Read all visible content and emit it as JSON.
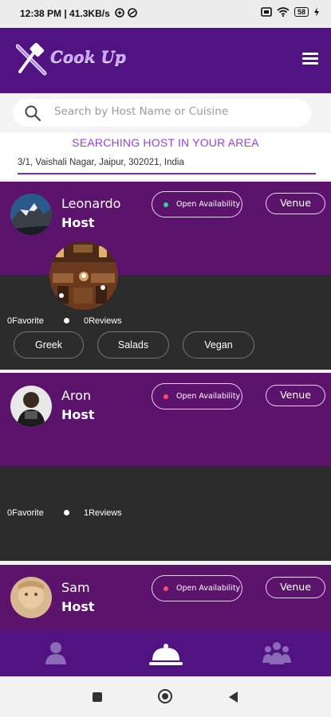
{
  "status_bar": {
    "time_speed": "12:38 PM | 41.3KB/s",
    "battery": "58"
  },
  "header": {
    "logo_text": "Cook Up"
  },
  "search": {
    "placeholder": "Search by Host Name or Cuisine",
    "value": ""
  },
  "area": {
    "title": "SEARCHING HOST IN YOUR AREA",
    "address": "3/1, Vaishali Nagar, Jaipur, 302021, India"
  },
  "hosts": [
    {
      "name": "Leonardo",
      "role": "Host",
      "availability_label": "Open Availability",
      "availability_color": "#2ed39b",
      "venue_label": "Venue",
      "favorites": "0Favorite",
      "reviews": "0Reviews",
      "cuisines": [
        "Greek",
        "Salads",
        "Vegan"
      ]
    },
    {
      "name": "Aron",
      "role": "Host",
      "availability_label": "Open Availability",
      "availability_color": "#ff4d6d",
      "venue_label": "Venue",
      "favorites": "0Favorite",
      "reviews": "1Reviews",
      "cuisines": []
    },
    {
      "name": "Sam",
      "role": "Host",
      "availability_label": "Open Availability",
      "availability_color": "#ff4d6d",
      "venue_label": "Venue"
    }
  ],
  "bottom_nav": {
    "items": [
      {
        "icon": "profile-icon",
        "active": false
      },
      {
        "icon": "cloche-icon",
        "active": true
      },
      {
        "icon": "community-icon",
        "active": false
      }
    ]
  },
  "colors": {
    "brand": "#511282",
    "card_top": "#5c136c",
    "card_bottom": "#2c2c2c",
    "accent_text": "#9c3cf0"
  }
}
